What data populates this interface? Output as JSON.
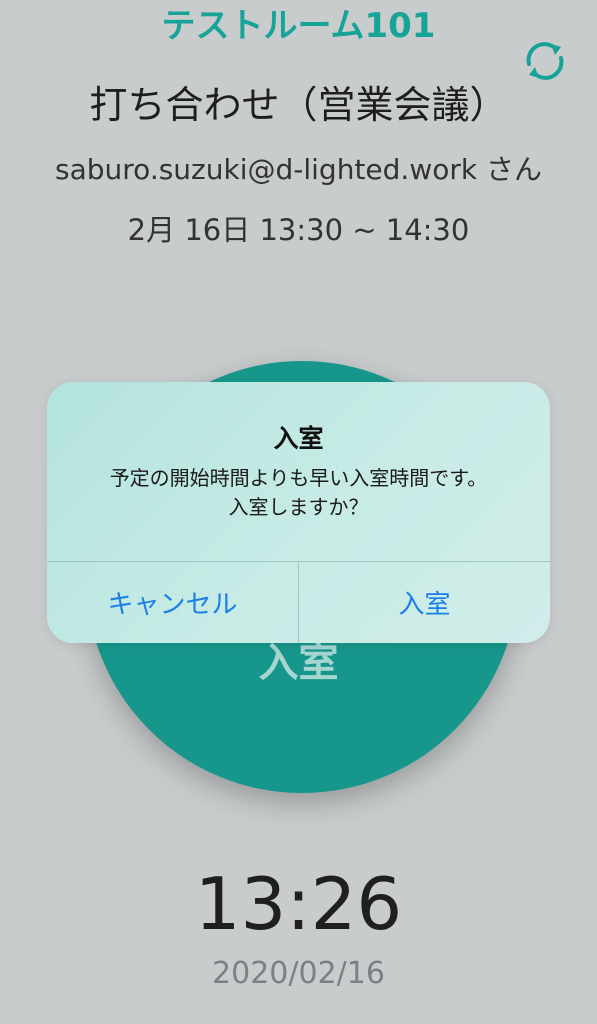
{
  "header": {
    "room_name": "テストルーム101",
    "refresh_icon": "refresh-icon",
    "accent_color": "#16a398"
  },
  "meeting": {
    "title": "打ち合わせ（営業会議）",
    "user_line": "saburo.suzuki@d-lighted.work さん",
    "time_range": "2月 16日 13:30 ~ 14:30"
  },
  "enter_button": {
    "label": "入室",
    "color": "#17978c"
  },
  "clock": {
    "time": "13:26",
    "date": "2020/02/16"
  },
  "alert": {
    "title": "入室",
    "message_line1": "予定の開始時間よりも早い入室時間です。",
    "message_line2": "入室しますか？",
    "cancel_label": "キャンセル",
    "confirm_label": "入室",
    "button_color": "#1a7fe6"
  }
}
